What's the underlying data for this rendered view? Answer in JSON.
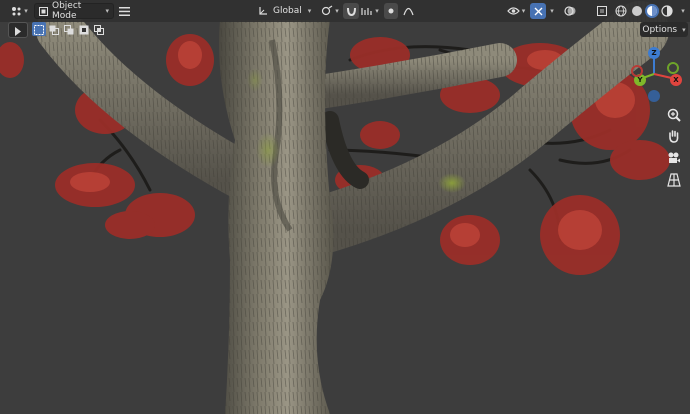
{
  "header": {
    "mode_label": "Object Mode",
    "transform_orientation": "Global"
  },
  "options_label": "Options",
  "gizmo": {
    "z_label": "Z",
    "y_label": "Y",
    "x_label": "X"
  },
  "colors": {
    "accent_blue": "#4772b3",
    "axis_x": "#e0443e",
    "axis_y": "#7fb82a",
    "axis_z": "#3d7cd1",
    "foliage": "#a0302a"
  }
}
